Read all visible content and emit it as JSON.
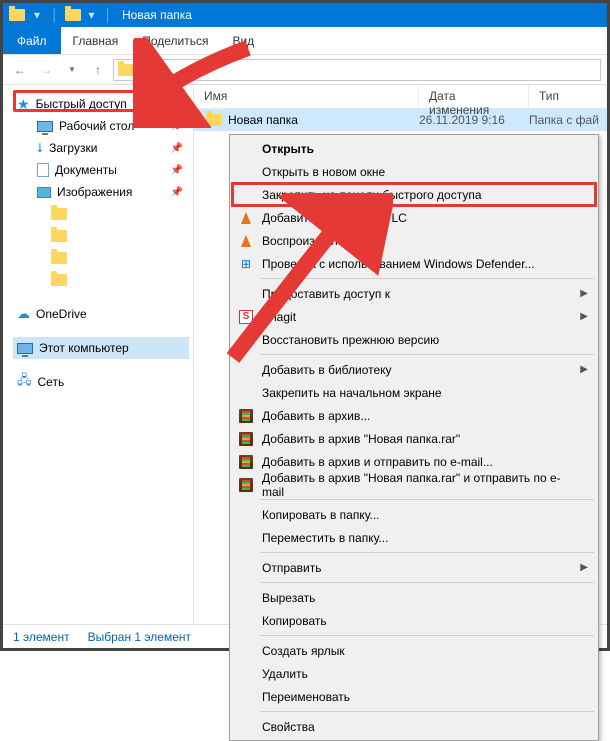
{
  "titlebar": {
    "title": "Новая папка"
  },
  "ribbon": {
    "file": "Файл",
    "home": "Главная",
    "share": "Поделиться",
    "view": "Вид"
  },
  "cols": {
    "name": "Имя",
    "date": "Дата изменения",
    "type": "Тип"
  },
  "row": {
    "name": "Новая папка",
    "date": "26.11.2019 9:16",
    "type": "Папка с фай"
  },
  "sidebar": {
    "quick": "Быстрый доступ",
    "desktop": "Рабочий стол",
    "downloads": "Загрузки",
    "documents": "Документы",
    "pictures": "Изображения",
    "onedrive": "OneDrive",
    "thispc": "Этот компьютер",
    "network": "Сеть"
  },
  "status": {
    "count": "1 элемент",
    "sel": "Выбран 1 элемент"
  },
  "ctx": {
    "open": "Открыть",
    "openNew": "Открыть в новом окне",
    "pin": "Закрепить на панели быстрого доступа",
    "vlcAdd": "Добавить в плейлист VLC",
    "vlcPlay": "Воспроизвести в VLC",
    "defender": "Проверка с использованием Windows Defender...",
    "grant": "Предоставить доступ к",
    "snagit": "Snagit",
    "restore": "Восстановить прежнюю версию",
    "library": "Добавить в библиотеку",
    "pinStart": "Закрепить на начальном экране",
    "rar1": "Добавить в архив...",
    "rar2": "Добавить в архив \"Новая папка.rar\"",
    "rar3": "Добавить в архив и отправить по e-mail...",
    "rar4": "Добавить в архив \"Новая папка.rar\" и отправить по e-mail",
    "copyTo": "Копировать в папку...",
    "moveTo": "Переместить в папку...",
    "send": "Отправить",
    "cut": "Вырезать",
    "copy": "Копировать",
    "shortcut": "Создать ярлык",
    "delete": "Удалить",
    "rename": "Переименовать",
    "props": "Свойства"
  }
}
